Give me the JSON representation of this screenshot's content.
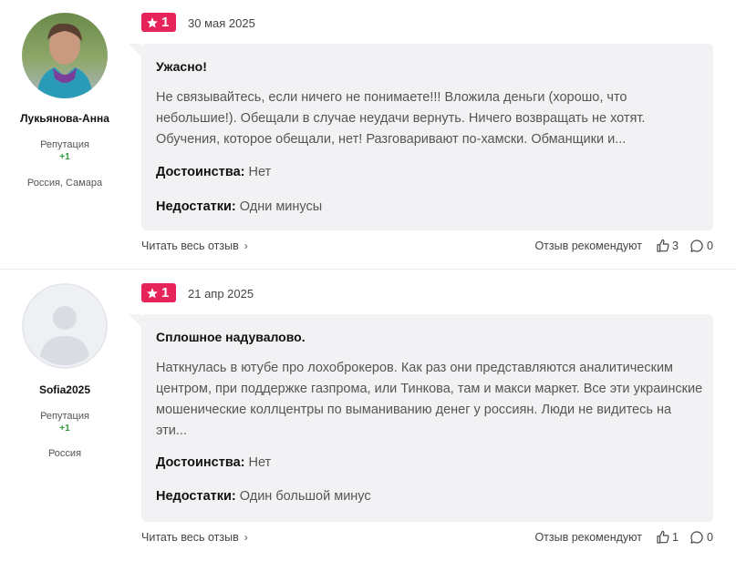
{
  "reviews": [
    {
      "author": "Лукьянова-Анна",
      "reputation_label": "Репутация",
      "reputation_value": "+1",
      "location": "Россия, Самара",
      "rating": "1",
      "date": "30 мая 2025",
      "title": "Ужасно!",
      "text": "Не связывайтесь, если ничего не понимаете!!! Вложила деньги (хорошо, что небольшие!). Обещали в случае неудачи вернуть. Ничего возвращать не хотят. Обучения, которое обещали, нет! Разговаривают по-хамски. Обманщики и...",
      "pros_label": "Достоинства:",
      "pros": "Нет",
      "cons_label": "Недостатки:",
      "cons": "Одни минусы",
      "read_more": "Читать весь отзыв",
      "recommend_label": "Отзыв рекомендуют",
      "likes": "3",
      "comments": "0"
    },
    {
      "author": "Sofia2025",
      "reputation_label": "Репутация",
      "reputation_value": "+1",
      "location": "Россия",
      "rating": "1",
      "date": "21 апр 2025",
      "title": "Сплошное надувалово.",
      "text": "Наткнулась в ютубе про лохоброкеров. Как раз они представляются аналитическим центром, при поддержке газпрома, или Тинкова, там и макси маркет. Все эти украинские мошенические коллцентры по выманиванию денег у россиян. Люди не видитесь на эти...",
      "pros_label": "Достоинства:",
      "pros": "Нет",
      "cons_label": "Недостатки:",
      "cons": "Один большой минус",
      "read_more": "Читать весь отзыв",
      "recommend_label": "Отзыв рекомендуют",
      "likes": "1",
      "comments": "0"
    }
  ],
  "colors": {
    "rating_badge": "#e6245a",
    "reputation": "#2e9a3a",
    "bubble_bg": "#f2f2f4"
  },
  "icons": [
    "star-icon",
    "thumbs-up-icon",
    "comment-icon",
    "chevron-right-icon",
    "avatar-placeholder-icon"
  ]
}
